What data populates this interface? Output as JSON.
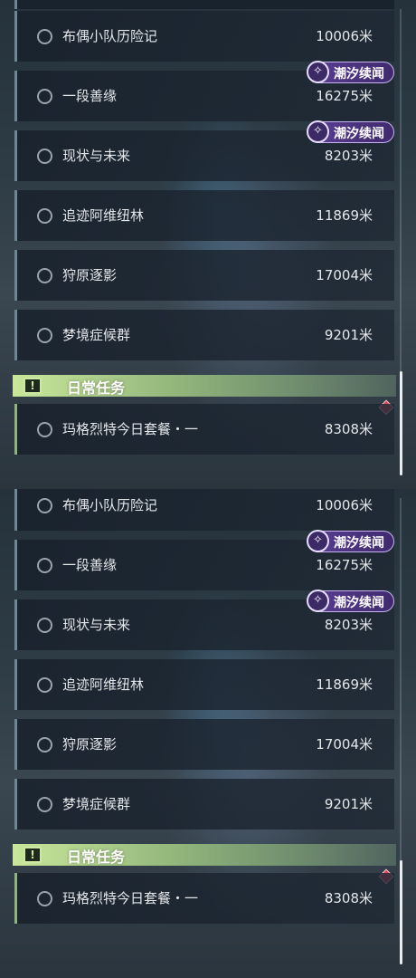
{
  "panels": [
    {
      "quests": [
        {
          "title": "布偶小队历险记",
          "distance": "10006米",
          "badge": ""
        },
        {
          "title": "一段善缘",
          "distance": "16275米",
          "badge": "潮汐续闻"
        },
        {
          "title": "现状与未来",
          "distance": "8203米",
          "badge": "潮汐续闻"
        },
        {
          "title": "追迹阿维纽林",
          "distance": "11869米",
          "badge": ""
        },
        {
          "title": "狩原逐影",
          "distance": "17004米",
          "badge": ""
        },
        {
          "title": "梦境症候群",
          "distance": "9201米",
          "badge": ""
        }
      ],
      "daily_section": {
        "title": "日常任务",
        "icon": "exclamation-icon"
      },
      "daily_quests": [
        {
          "title": "玛格烈特今日套餐・一",
          "distance": "8308米"
        }
      ]
    },
    {
      "quests": [
        {
          "title": "布偶小队历险记",
          "distance": "10006米",
          "badge": ""
        },
        {
          "title": "一段善缘",
          "distance": "16275米",
          "badge": "潮汐续闻"
        },
        {
          "title": "现状与未来",
          "distance": "8203米",
          "badge": "潮汐续闻"
        },
        {
          "title": "追迹阿维纽林",
          "distance": "11869米",
          "badge": ""
        },
        {
          "title": "狩原逐影",
          "distance": "17004米",
          "badge": ""
        },
        {
          "title": "梦境症候群",
          "distance": "9201米",
          "badge": ""
        }
      ],
      "daily_section": {
        "title": "日常任务",
        "icon": "exclamation-icon"
      },
      "daily_quests": [
        {
          "title": "玛格烈特今日套餐・一",
          "distance": "8308米"
        }
      ]
    }
  ],
  "colors": {
    "badge": "#5a3f93",
    "daily_header": "#c9e69a",
    "marker": "#d64a5c"
  }
}
